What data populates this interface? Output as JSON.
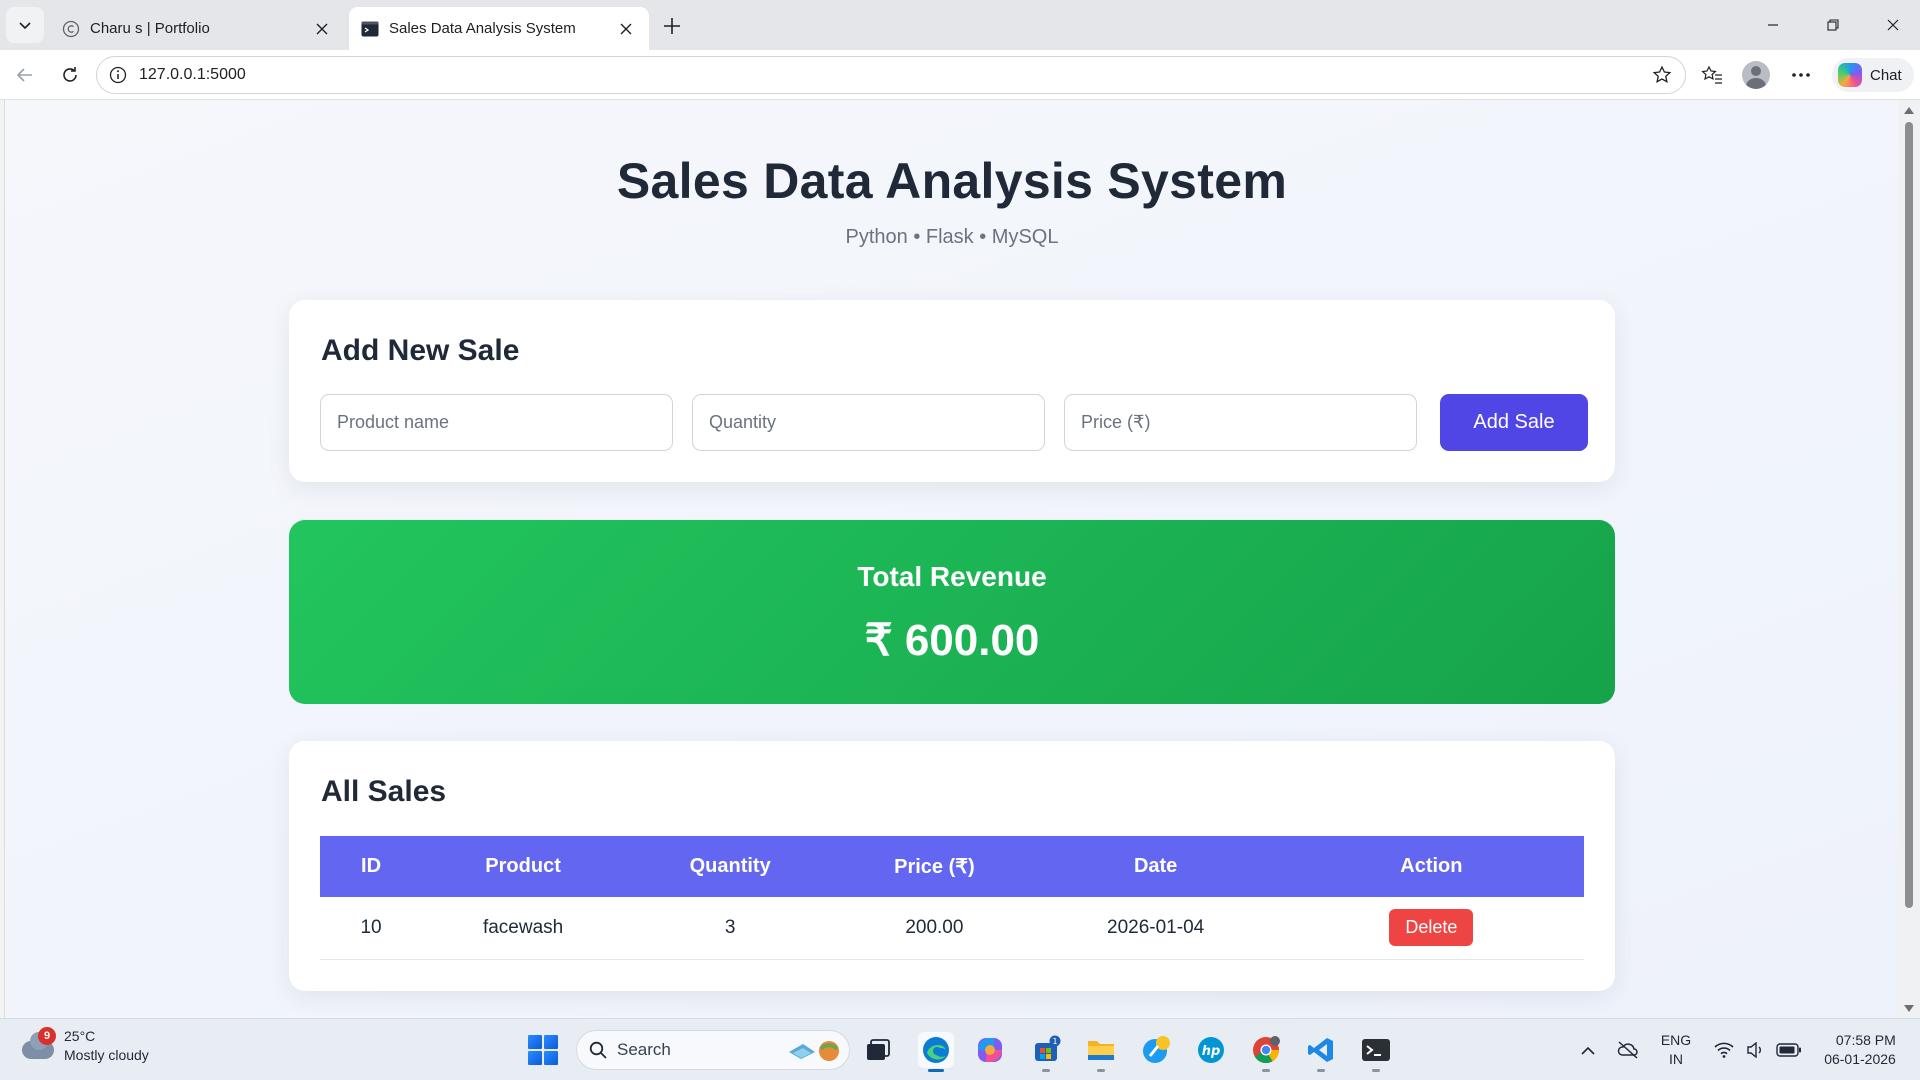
{
  "browser": {
    "tabs": [
      {
        "title": "Charu s | Portfolio",
        "active": false,
        "icon": "copyright-icon"
      },
      {
        "title": "Sales Data Analysis System",
        "active": true,
        "icon": "terminal-icon"
      }
    ],
    "url": "127.0.0.1:5000",
    "chat_label": "Chat"
  },
  "page": {
    "title": "Sales Data Analysis System",
    "subtitle": "Python • Flask • MySQL",
    "add_sale": {
      "heading": "Add New Sale",
      "product_placeholder": "Product name",
      "quantity_placeholder": "Quantity",
      "price_placeholder": "Price (₹)",
      "submit_label": "Add Sale"
    },
    "revenue": {
      "label": "Total Revenue",
      "value": "₹ 600.00"
    },
    "sales": {
      "heading": "All Sales",
      "columns": [
        "ID",
        "Product",
        "Quantity",
        "Price (₹)",
        "Date",
        "Action"
      ],
      "rows": [
        {
          "id": "10",
          "product": "facewash",
          "quantity": "3",
          "price": "200.00",
          "date": "2026-01-04",
          "action": "Delete"
        }
      ]
    }
  },
  "colors": {
    "accent": "#4f46e5",
    "table_header": "#6366f1",
    "revenue_start": "#22c55e",
    "revenue_end": "#16a34a",
    "danger": "#ef4444"
  },
  "taskbar": {
    "weather": {
      "temp": "25°C",
      "condition": "Mostly cloudy",
      "badge": "9"
    },
    "search_label": "Search",
    "store_badge": "1",
    "language": {
      "lang": "ENG",
      "region": "IN"
    },
    "time": "07:58 PM",
    "date": "06-01-2026"
  }
}
